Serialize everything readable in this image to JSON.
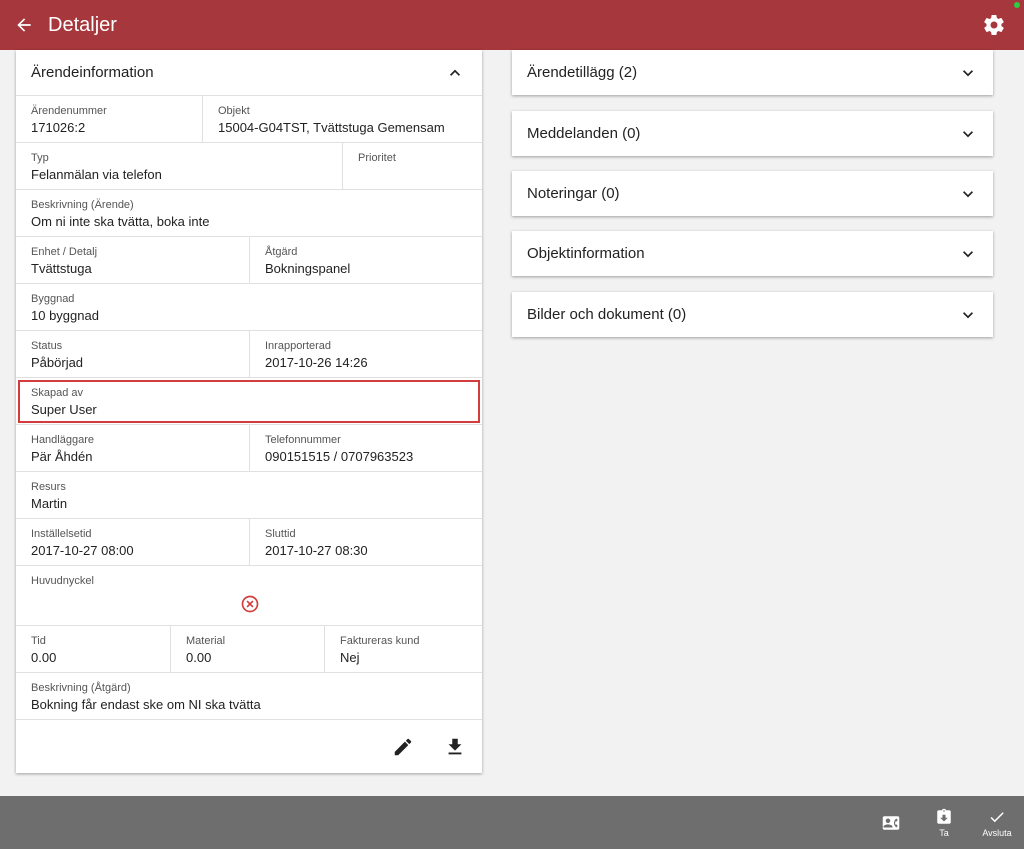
{
  "appbar": {
    "title": "Detaljer",
    "back_icon": "arrow-left-icon",
    "settings_icon": "gear-icon",
    "status_color": "#2ecc40"
  },
  "colors": {
    "primary": "#a6373c",
    "bottombar": "#6e6e6e",
    "highlight": "#d23c3c"
  },
  "case_info": {
    "title": "Ärendeinformation",
    "fields": {
      "case_number": {
        "label": "Ärendenummer",
        "value": "171026:2"
      },
      "object": {
        "label": "Objekt",
        "value": "15004-G04TST, Tvättstuga Gemensam"
      },
      "type": {
        "label": "Typ",
        "value": "Felanmälan via telefon"
      },
      "priority": {
        "label": "Prioritet",
        "value": ""
      },
      "description": {
        "label": "Beskrivning (Ärende)",
        "value": "Om ni inte ska tvätta, boka inte"
      },
      "unit": {
        "label": "Enhet / Detalj",
        "value": "Tvättstuga"
      },
      "action": {
        "label": "Åtgärd",
        "value": "Bokningspanel"
      },
      "building": {
        "label": "Byggnad",
        "value": "10 byggnad"
      },
      "status": {
        "label": "Status",
        "value": "Påbörjad"
      },
      "reported": {
        "label": "Inrapporterad",
        "value": "2017-10-26 14:26"
      },
      "created_by": {
        "label": "Skapad av",
        "value": "Super User"
      },
      "handler": {
        "label": "Handläggare",
        "value": "Pär Åhdén"
      },
      "phone": {
        "label": "Telefonnummer",
        "value": "090151515 / 0707963523"
      },
      "resource": {
        "label": "Resurs",
        "value": "Martin"
      },
      "set_time": {
        "label": "Inställelsetid",
        "value": "2017-10-27 08:00"
      },
      "end_time": {
        "label": "Sluttid",
        "value": "2017-10-27 08:30"
      },
      "master_key": {
        "label": "Huvudnyckel",
        "icon": "cancel-circle-icon"
      },
      "time": {
        "label": "Tid",
        "value": "0.00"
      },
      "material": {
        "label": "Material",
        "value": "0.00"
      },
      "bill_customer": {
        "label": "Faktureras kund",
        "value": "Nej"
      },
      "action_description": {
        "label": "Beskrivning (Åtgärd)",
        "value": "Bokning får endast ske om NI ska tvätta"
      }
    }
  },
  "panels": [
    {
      "title": "Ärendetillägg (2)"
    },
    {
      "title": "Meddelanden (0)"
    },
    {
      "title": "Noteringar (0)"
    },
    {
      "title": "Objektinformation"
    },
    {
      "title": "Bilder och dokument (0)"
    }
  ],
  "bottombar": {
    "buttons": [
      {
        "icon": "contact-card-icon",
        "label": ""
      },
      {
        "icon": "clipboard-download-icon",
        "label": "Ta"
      },
      {
        "icon": "check-icon",
        "label": "Avsluta"
      }
    ]
  }
}
